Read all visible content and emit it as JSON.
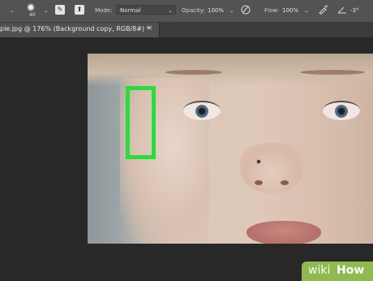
{
  "options_bar": {
    "brush_size": "40",
    "mode_label": "Mode:",
    "mode_value": "Normal",
    "opacity_label": "Opacity:",
    "opacity_value": "100%",
    "flow_label": "Flow:",
    "flow_value": "100%",
    "angle_value": "-3°"
  },
  "document_tab": {
    "title": "ple.jpg @ 176% (Background copy, RGB/8#) *",
    "close_symbol": "×"
  },
  "overlay": {
    "highlight_color": "#2bdc3d"
  },
  "watermark": {
    "wiki": "wiki",
    "how": "How",
    "badge_color": "#8dbb4f"
  },
  "icons": [
    "brush-preset-icon",
    "brush-settings-icon",
    "toggle-pen-pressure-icon",
    "airbrush-icon",
    "smoothing-icon",
    "angle-icon"
  ]
}
